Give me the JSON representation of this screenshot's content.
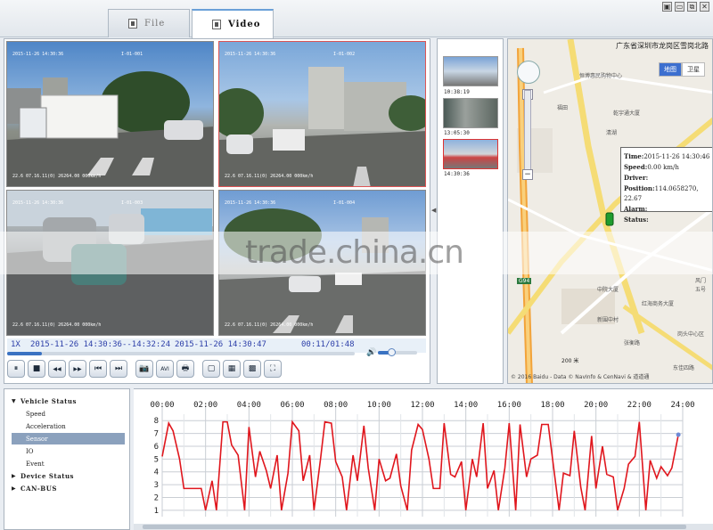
{
  "tabs": [
    {
      "label": "File",
      "active": false
    },
    {
      "label": "Video",
      "active": true
    }
  ],
  "window_buttons": [
    "▣",
    "▭",
    "⧉",
    "✕"
  ],
  "cameras": [
    {
      "timestamp": "2015-11-26 14:30:36",
      "channel": "I-01-001",
      "info": "22.6 07.16.11(0) 26264.00 000km/h"
    },
    {
      "timestamp": "2015-11-26 14:30:36",
      "channel": "I-01-002",
      "info": "22.6 07.16.11(0) 26264.00 000km/h"
    },
    {
      "timestamp": "2015-11-26 14:30:36",
      "channel": "I-01-003",
      "info": "22.6 07.16.11(0) 26264.00 000km/h"
    },
    {
      "timestamp": "2015-11-26 14:30:36",
      "channel": "I-01-004",
      "info": "22.6 07.16.11(0) 26264.00 000km/h"
    }
  ],
  "playback": {
    "speed": "1X",
    "range": "2015-11-26 14:30:36--14:32:24",
    "current": "2015-11-26 14:30:47",
    "elapsed": "00:11/01:48",
    "progress_fraction": 0.1,
    "volume_fraction": 0.35
  },
  "controls": [
    "⏸",
    "■",
    "◀◀",
    "▶▶",
    "⏮",
    "⏭",
    "📷",
    "AVI",
    "🖶",
    "▢",
    "▦",
    "▩",
    "⛶"
  ],
  "thumbnails": [
    {
      "time": "10:38:19"
    },
    {
      "time": "13:05:30"
    },
    {
      "time": "14:30:36",
      "selected": true
    }
  ],
  "map": {
    "title": "广东省深圳市龙岗区雪岗北路",
    "types": [
      "地图",
      "卫星"
    ],
    "active_type": "地图",
    "labels": [
      "福田",
      "恒博惠民购物中心",
      "乾宇通大厦",
      "清湖",
      "中院大厦",
      "红海商务大厦",
      "新围中村",
      "岗头中心区",
      "张衡路",
      "东佳四路",
      "G94",
      "风门",
      "五号"
    ],
    "popup": {
      "time": "2015-11-26 14:30:46",
      "speed": "0.00 km/h",
      "driver": "",
      "position": "114.0658270, 22.67",
      "alarm": "",
      "status": ""
    },
    "popup_labels": {
      "time": "Time:",
      "speed": "Speed:",
      "driver": "Driver:",
      "position": "Position:",
      "alarm": "Alarm:",
      "status": "Status:"
    },
    "scale": "200 米",
    "copyright": "© 2016 Baidu - Data © NavInfo & CenNavi & 道道通"
  },
  "watermark": "trade.china.cn",
  "tree": [
    {
      "label": "Vehicle Status",
      "level": 0,
      "expanded": true
    },
    {
      "label": "Speed",
      "level": 1
    },
    {
      "label": "Acceleration",
      "level": 1
    },
    {
      "label": "Sensor",
      "level": 1,
      "selected": true
    },
    {
      "label": "IO",
      "level": 1
    },
    {
      "label": "Event",
      "level": 1
    },
    {
      "label": "Device Status",
      "level": 0,
      "expanded": false
    },
    {
      "label": "CAN-BUS",
      "level": 0,
      "expanded": false
    }
  ],
  "chart_data": {
    "type": "line",
    "x_ticks": [
      "00:00",
      "02:00",
      "04:00",
      "06:00",
      "08:00",
      "10:00",
      "12:00",
      "14:00",
      "16:00",
      "18:00",
      "20:00",
      "22:00",
      "24:00"
    ],
    "y_ticks": [
      1,
      2,
      3,
      4,
      5,
      6,
      7,
      8
    ],
    "ylim": [
      0.5,
      8.5
    ],
    "xlim": [
      0,
      24
    ],
    "grid": true,
    "line_color": "#e0161d",
    "x": [
      0.0,
      0.3,
      0.5,
      0.8,
      1.0,
      1.3,
      1.5,
      1.8,
      2.0,
      2.3,
      2.5,
      2.8,
      3.0,
      3.2,
      3.5,
      3.8,
      4.0,
      4.3,
      4.5,
      4.8,
      5.0,
      5.3,
      5.5,
      5.8,
      6.0,
      6.3,
      6.5,
      6.8,
      7.0,
      7.3,
      7.5,
      7.8,
      8.0,
      8.3,
      8.5,
      8.8,
      9.0,
      9.3,
      9.5,
      9.8,
      10.0,
      10.3,
      10.5,
      10.8,
      11.0,
      11.3,
      11.5,
      11.8,
      12.0,
      12.3,
      12.5,
      12.8,
      13.0,
      13.3,
      13.5,
      13.8,
      14.0,
      14.3,
      14.5,
      14.8,
      15.0,
      15.3,
      15.5,
      15.8,
      16.0,
      16.3,
      16.5,
      16.8,
      17.0,
      17.3,
      17.5,
      17.8,
      18.0,
      18.3,
      18.5,
      18.8,
      19.0,
      19.3,
      19.5,
      19.8,
      20.0,
      20.3,
      20.5,
      20.8,
      21.0,
      21.3,
      21.5,
      21.8,
      22.0,
      22.3,
      22.5,
      22.8,
      23.0,
      23.3,
      23.5,
      23.8
    ],
    "values": [
      5.2,
      7.8,
      7.2,
      5.0,
      2.7,
      2.7,
      2.7,
      2.7,
      1.0,
      3.3,
      1.0,
      7.9,
      7.9,
      6.1,
      5.3,
      1.0,
      7.5,
      3.6,
      5.6,
      4.1,
      2.7,
      5.3,
      1.0,
      3.9,
      7.9,
      7.2,
      3.3,
      5.3,
      1.0,
      5.0,
      7.9,
      7.8,
      4.8,
      3.6,
      1.0,
      5.3,
      3.3,
      7.6,
      4.3,
      1.0,
      5.0,
      3.3,
      3.5,
      5.4,
      2.9,
      1.0,
      5.7,
      7.7,
      7.3,
      5.0,
      2.7,
      2.7,
      7.8,
      3.8,
      3.6,
      4.8,
      1.0,
      5.0,
      3.6,
      7.8,
      2.7,
      4.1,
      1.0,
      4.3,
      7.8,
      1.0,
      7.7,
      3.6,
      5.0,
      5.3,
      7.7,
      7.7,
      5.0,
      1.0,
      3.9,
      3.7,
      7.2,
      2.8,
      1.0,
      6.8,
      2.7,
      6.0,
      3.8,
      3.6,
      1.0,
      2.7,
      4.6,
      5.2,
      7.9,
      1.0,
      4.9,
      3.5,
      4.4,
      3.7,
      4.3,
      6.9
    ]
  }
}
